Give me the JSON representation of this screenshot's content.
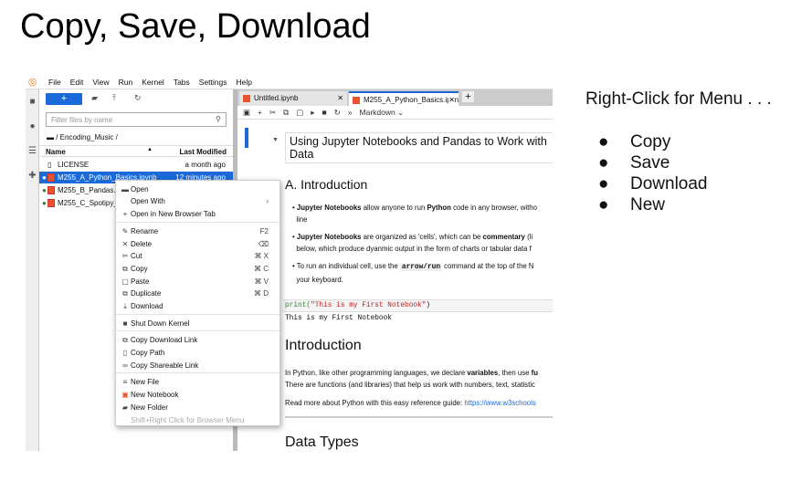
{
  "slide_title": "Copy, Save, Download",
  "notes": {
    "heading": "Right-Click for Menu . . .",
    "bullets": [
      "Copy",
      "Save",
      "Download",
      "New"
    ]
  },
  "menubar": [
    "File",
    "Edit",
    "View",
    "Run",
    "Kernel",
    "Tabs",
    "Settings",
    "Help"
  ],
  "filebrowser": {
    "new_label": "+",
    "filter_placeholder": "Filter files by name",
    "breadcrumb": "/ Encoding_Music /",
    "col_name": "Name",
    "col_modified": "Last Modified",
    "files": [
      {
        "name": "LICENSE",
        "modified": "a month ago"
      },
      {
        "name": "M255_A_Python_Basics.ipynb",
        "modified": "12 minutes ago"
      },
      {
        "name": "M255_B_Pandas.ipynb",
        "modified": ""
      },
      {
        "name": "M255_C_Spotipy_",
        "modified": ""
      }
    ]
  },
  "tabs": [
    {
      "label": "Untitled.ipynb"
    },
    {
      "label": "M255_A_Python_Basics.ipynb"
    }
  ],
  "notebook_toolbar": {
    "cell_type": "Markdown"
  },
  "notebook": {
    "title": "Using Jupyter Notebooks and Pandas to Work with Data",
    "section": "A. Introduction",
    "bullets": [
      {
        "b": "Jupyter Notebooks",
        "t1": " allow anyone to run ",
        "b2": "Python",
        "t2": " code in any browser, witho",
        "t3": "line"
      },
      {
        "b": "Jupyter Notebooks",
        "t1": " are organized as 'cells', which can be ",
        "b2": "commentary",
        "t2": " (li",
        "t3": "below, which produce dyanmic output in the form of charts or tabular data f"
      },
      {
        "t1": "To run an individual cell, use the ",
        "code": "arrow/run",
        "t2": " command at the top of the N",
        "t3": "your keyboard."
      }
    ],
    "code_fn": "print(",
    "code_str": "\"This is my First Notebook\"",
    "code_end": ")",
    "output": "This is my First Notebook",
    "h_intro": "Introduction",
    "p1a": "In Python, like other programming languages, we declare ",
    "p1b": "variables",
    "p1c": ", then use ",
    "p1d": "fu",
    "p2": "There are functions (and libraries) that help us work with numbers, text, statistic",
    "p3": "Read more about Python with this easy reference guide: ",
    "link": "https://www.w3schools",
    "h_types": "Data Types"
  },
  "context_menu": [
    {
      "label": "Open",
      "icon": "folder-icon"
    },
    {
      "label": "Open With",
      "submenu": "›"
    },
    {
      "label": "Open in New Browser Tab",
      "icon": "plus-icon"
    },
    {
      "label": "Rename",
      "shortcut": "F2",
      "icon": "pencil-icon"
    },
    {
      "label": "Delete",
      "shortcut": "⌫",
      "icon": "close-icon"
    },
    {
      "label": "Cut",
      "shortcut": "⌘ X",
      "icon": "scissors-icon"
    },
    {
      "label": "Copy",
      "shortcut": "⌘ C",
      "icon": "copy-icon"
    },
    {
      "label": "Paste",
      "shortcut": "⌘ V",
      "icon": "paste-icon"
    },
    {
      "label": "Duplicate",
      "shortcut": "⌘ D",
      "icon": "duplicate-icon"
    },
    {
      "label": "Download",
      "icon": "download-icon"
    },
    {
      "label": "Shut Down Kernel",
      "icon": "stop-icon"
    },
    {
      "label": "Copy Download Link",
      "icon": "copy-icon"
    },
    {
      "label": "Copy Path",
      "icon": "file-icon"
    },
    {
      "label": "Copy Shareable Link",
      "icon": "link-icon"
    },
    {
      "label": "New File",
      "icon": "text-file-icon"
    },
    {
      "label": "New Notebook",
      "icon": "notebook-icon"
    },
    {
      "label": "New Folder",
      "icon": "new-folder-icon"
    },
    {
      "label": "Shift+Right Click for Browser Menu"
    }
  ],
  "colors": {
    "accent": "#1a6ad9",
    "notebook_icon": "#e8552c"
  }
}
